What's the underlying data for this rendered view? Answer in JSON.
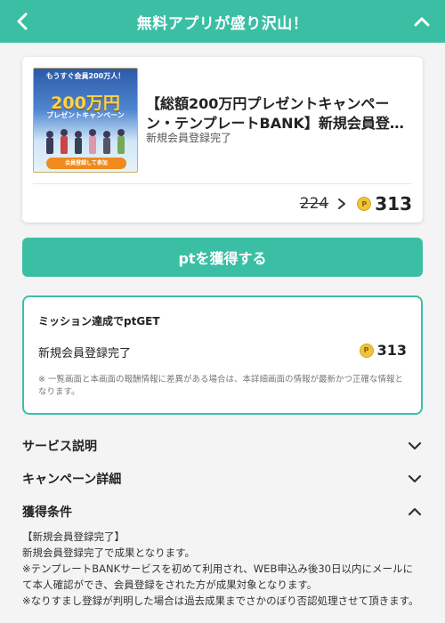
{
  "header": {
    "title": "無料アプリが盛り沢山！",
    "back_icon": "chevron-left-icon",
    "collapse_icon": "chevron-up-icon"
  },
  "offer": {
    "banner": {
      "top_text": "もうすぐ会員200万人！",
      "amount": "200万円",
      "campaign": "プレゼントキャンペーン",
      "cta": "会員登録して参加"
    },
    "title": "【総額200万円プレゼントキャンペーン・テンプレートBANK】新規会員登録プロ…",
    "subtitle": "新規会員登録完了",
    "old_points": "224",
    "new_points": "313",
    "coin_symbol": "P"
  },
  "action": {
    "get_button": "ptを獲得する"
  },
  "mission": {
    "title": "ミッション達成でptGET",
    "item_label": "新規会員登録完了",
    "item_points": "313",
    "note": "※ 一覧画面と本画面の報酬情報に差異がある場合は、本詳細画面の情報が最新かつ正確な情報となります。"
  },
  "sections": {
    "service": "サービス説明",
    "campaign": "キャンペーン詳細",
    "conditions": "獲得条件"
  },
  "conditions_body": {
    "line1": "【新規会員登録完了】",
    "line2": "新規会員登録完了で成果となります。",
    "line3": "※テンプレートBANKサービスを初めて利用され、WEB申込み後30日以内にメールにて本人確認ができ、会員登録をされた方が成果対象となります。",
    "line4": "※なりすまし登録が判明した場合は過去成果までさかのぼり否認処理させて頂きます。"
  },
  "colors": {
    "accent": "#3bbfa4",
    "coin": "#f0c43a"
  }
}
